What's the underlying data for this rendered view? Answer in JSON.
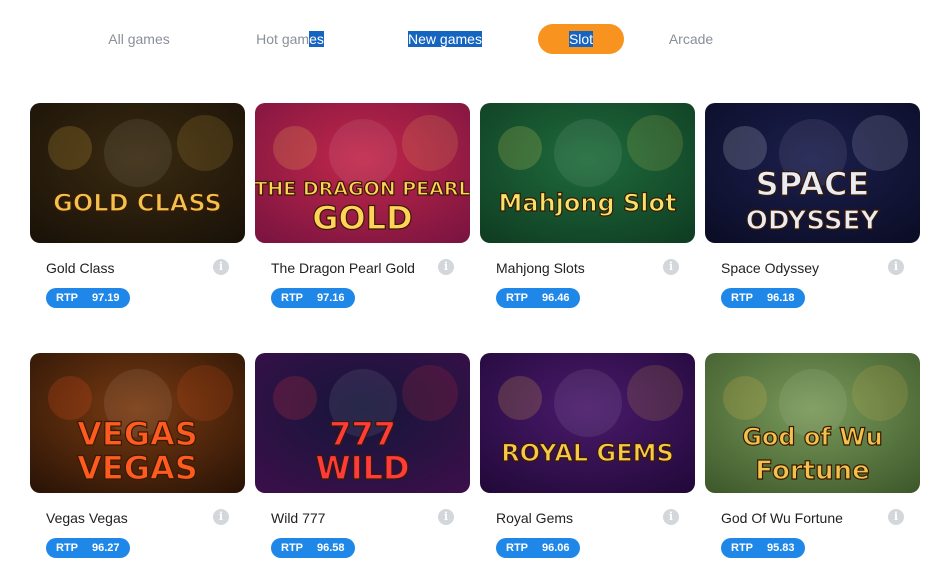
{
  "tabs": [
    {
      "label_a": "All games",
      "label_b": ""
    },
    {
      "label_a": "Hot gam",
      "label_b": "es"
    },
    {
      "label_a": "",
      "label_b": "New games"
    },
    {
      "label_a": "",
      "label_b": "Slot"
    },
    {
      "label_a": "Arcade",
      "label_b": ""
    }
  ],
  "rtp_label": "RTP",
  "games": [
    {
      "title": "Gold Class",
      "rtp": "97.19",
      "art": "GOLD CLASS",
      "art2": "",
      "colors": [
        "#3a2a10",
        "#1a1208",
        "#f2c14e"
      ]
    },
    {
      "title": "The Dragon Pearl Gold",
      "rtp": "97.16",
      "art": "THE DRAGON PEARL",
      "art2": "GOLD",
      "colors": [
        "#c2274a",
        "#7a1440",
        "#ffd35a"
      ]
    },
    {
      "title": "Mahjong Slots",
      "rtp": "96.46",
      "art": "Mahjong Slot",
      "art2": "",
      "colors": [
        "#1f6b3c",
        "#0f3d22",
        "#f5e26a"
      ]
    },
    {
      "title": "Space Odyssey",
      "rtp": "96.18",
      "art": "SPACE",
      "art2": "ODYSSEY",
      "colors": [
        "#1b1f4d",
        "#0b0d26",
        "#e8ecf5"
      ]
    },
    {
      "title": "Vegas Vegas",
      "rtp": "96.27",
      "art": "VEGAS",
      "art2": "VEGAS",
      "colors": [
        "#7a3b12",
        "#2a1406",
        "#ff5a1f"
      ]
    },
    {
      "title": "Wild 777",
      "rtp": "96.58",
      "art": "777",
      "art2": "WILD",
      "colors": [
        "#14163a",
        "#3b0f4a",
        "#ff3b3b"
      ]
    },
    {
      "title": "Royal Gems",
      "rtp": "96.06",
      "art": "ROYAL GEMS",
      "art2": "",
      "colors": [
        "#4a1a6b",
        "#22093a",
        "#f7c948"
      ]
    },
    {
      "title": "God Of Wu Fortune",
      "rtp": "95.83",
      "art": "God of Wu",
      "art2": "Fortune",
      "colors": [
        "#7a9a5a",
        "#3e5a2c",
        "#f2c14e"
      ]
    }
  ]
}
